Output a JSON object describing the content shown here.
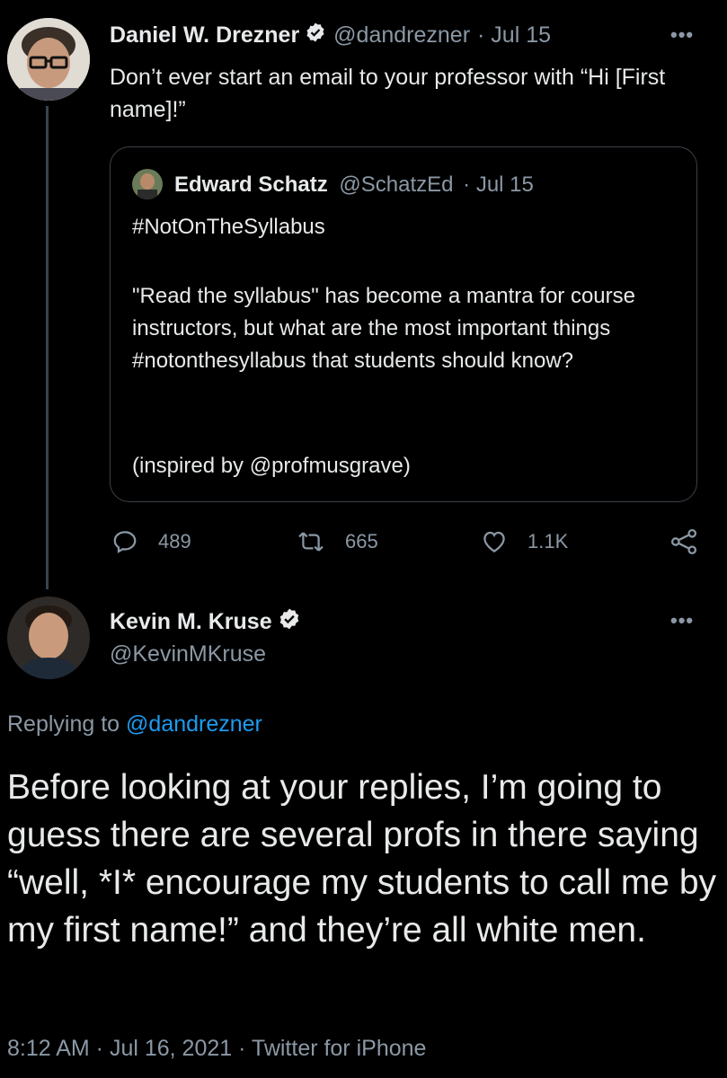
{
  "tweet1": {
    "author_name": "Daniel W. Drezner",
    "handle": "@dandrezner",
    "date": "· Jul 15",
    "more": "•••",
    "text": "Don’t ever start an email to your professor with “Hi [First name]!”",
    "actions": {
      "replies": "489",
      "retweets": "665",
      "likes": "1.1K"
    }
  },
  "quoted": {
    "author_name": "Edward Schatz",
    "handle": "@SchatzEd",
    "date": "· Jul 15",
    "line1": "#NotOnTheSyllabus",
    "paragraph": "\"Read the syllabus\" has become a mantra for course instructors, but what are the most important things #notonthesyllabus that students should know?",
    "footer": "(inspired by @profmusgrave)"
  },
  "reply": {
    "author_name": "Kevin M. Kruse",
    "handle": "@KevinMKruse",
    "more": "•••",
    "replying_prefix": "Replying to",
    "replying_to": "@dandrezner",
    "text": "Before looking at your replies, I’m going to guess there are several profs in there saying “well, *I* encourage my students to call me by my first name!” and they’re all white men.",
    "timestamp": "8:12 AM · Jul 16, 2021 · Twitter for iPhone"
  },
  "colors": {
    "background": "#000000",
    "text": "#e7e9ea",
    "muted": "#8b98a5",
    "link": "#1d9bf0"
  },
  "icons": [
    "reply-icon",
    "retweet-icon",
    "like-icon",
    "share-icon",
    "verified-badge-icon",
    "more-icon"
  ]
}
